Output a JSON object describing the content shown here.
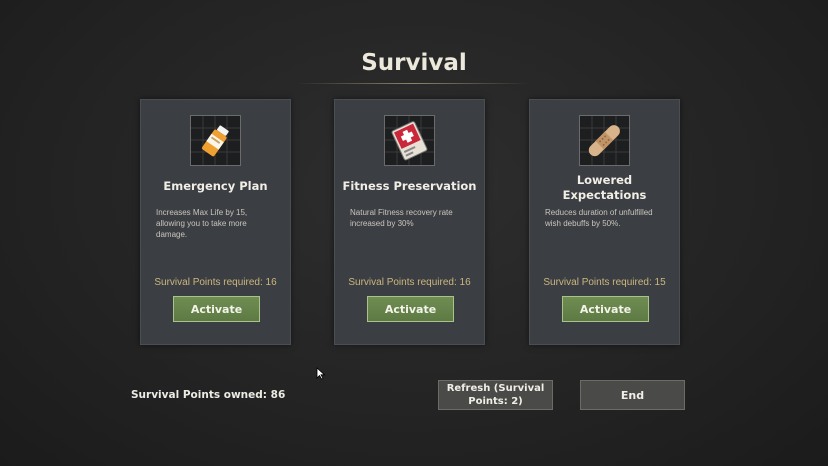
{
  "title": "Survival",
  "cards": [
    {
      "name": "Emergency Plan",
      "icon": "pill-bottle-icon",
      "description": "Increases Max Life by 15, allowing you to take more damage.",
      "points_required": "Survival Points required: 16",
      "activate_label": "Activate"
    },
    {
      "name": "Fitness Preservation",
      "icon": "first-aid-card-icon",
      "description": "Natural Fitness recovery rate increased by 30%",
      "points_required": "Survival Points required: 16",
      "activate_label": "Activate"
    },
    {
      "name": "Lowered Expectations",
      "icon": "bandage-icon",
      "description": "Reduces duration of unfulfilled wish debuffs by 50%.",
      "points_required": "Survival Points required: 15",
      "activate_label": "Activate"
    }
  ],
  "footer": {
    "owned": "Survival Points owned: 86",
    "refresh_label": "Refresh (Survival Points: 2)",
    "end_label": "End"
  },
  "colors": {
    "activate_green": "#5d7a44",
    "points_gold": "#cdb77f",
    "card_bg": "#3b3e42"
  }
}
